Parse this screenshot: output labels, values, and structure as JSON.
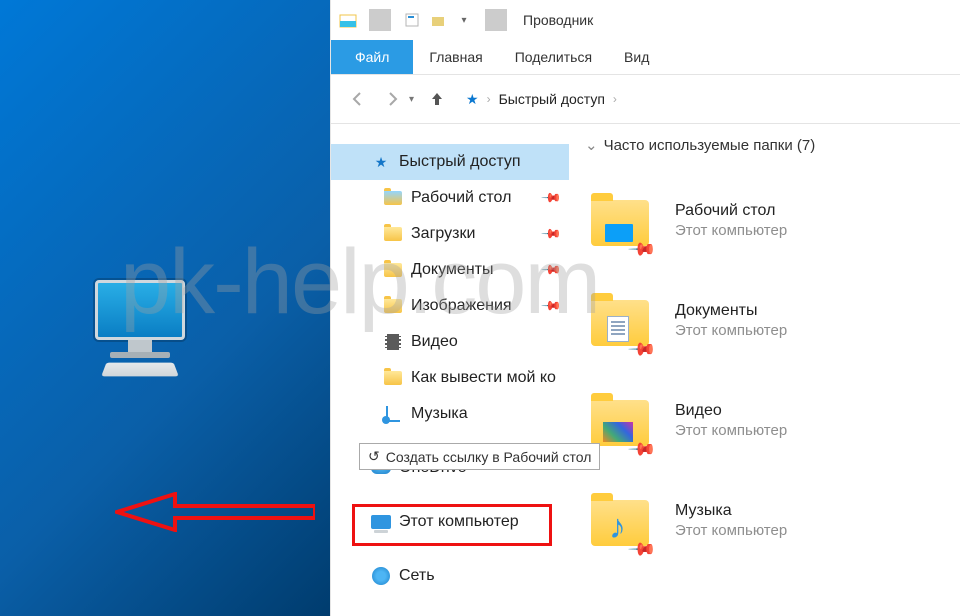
{
  "window_title": "Проводник",
  "ribbon": {
    "file": "Файл",
    "home": "Главная",
    "share": "Поделиться",
    "view": "Вид"
  },
  "breadcrumb": {
    "root": "Быстрый доступ"
  },
  "tree": {
    "quick": "Быстрый доступ",
    "desktop": "Рабочий стол",
    "downloads": "Загрузки",
    "documents": "Документы",
    "pictures": "Изображения",
    "video": "Видео",
    "howto": "Как вывести мой ко",
    "music": "Музыка",
    "onedrive": "OneDrive",
    "thispc": "Этот компьютер",
    "network": "Сеть"
  },
  "tooltip": "Создать ссылку в Рабочий стол",
  "section_title": "Часто используемые папки (7)",
  "folders": [
    {
      "name": "Рабочий стол",
      "loc": "Этот компьютер",
      "kind": "desk"
    },
    {
      "name": "Документы",
      "loc": "Этот компьютер",
      "kind": "doc"
    },
    {
      "name": "Видео",
      "loc": "Этот компьютер",
      "kind": "vid"
    },
    {
      "name": "Музыка",
      "loc": "Этот компьютер",
      "kind": "mus"
    }
  ],
  "watermark": "pk-help.com"
}
